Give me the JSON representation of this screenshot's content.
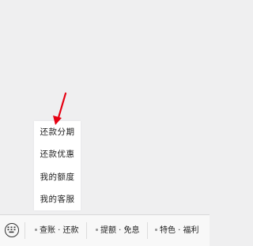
{
  "popup_menu": {
    "items": [
      {
        "label": "还款分期"
      },
      {
        "label": "还款优惠"
      },
      {
        "label": "我的额度"
      },
      {
        "label": "我的客服"
      }
    ]
  },
  "bottom_menu": {
    "tabs": [
      {
        "label": "查账 · 还款"
      },
      {
        "label": "提额 · 免息"
      },
      {
        "label": "特色 · 福利"
      }
    ]
  },
  "icons": {
    "keyboard": "keyboard-icon",
    "arrow": "red-arrow-icon"
  },
  "colors": {
    "arrow": "#e60012",
    "background": "#efeff0",
    "bar": "#f8f8f8"
  }
}
